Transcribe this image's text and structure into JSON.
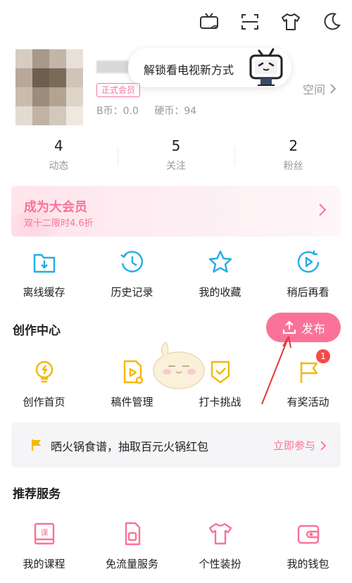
{
  "tooltip": {
    "text": "解锁看电视新方式"
  },
  "profile": {
    "member_badge": "正式会员",
    "b_coin": "B币：0.0",
    "hard_coin": "硬币：94",
    "space_label": "空间"
  },
  "stats": [
    {
      "value": "4",
      "label": "动态"
    },
    {
      "value": "5",
      "label": "关注"
    },
    {
      "value": "2",
      "label": "粉丝"
    }
  ],
  "vip_banner": {
    "title": "成为大会员",
    "subtitle": "双十二限时4.6折"
  },
  "quick_actions": [
    {
      "label": "离线缓存",
      "icon": "download-folder-icon"
    },
    {
      "label": "历史记录",
      "icon": "history-clock-icon"
    },
    {
      "label": "我的收藏",
      "icon": "star-icon"
    },
    {
      "label": "稍后再看",
      "icon": "watch-later-icon"
    }
  ],
  "creation": {
    "title": "创作中心",
    "publish_label": "发布",
    "items": [
      {
        "label": "创作首页",
        "icon": "bulb-icon"
      },
      {
        "label": "稿件管理",
        "icon": "manuscript-icon"
      },
      {
        "label": "打卡挑战",
        "icon": "checkin-shield-icon"
      },
      {
        "label": "有奖活动",
        "icon": "reward-flag-icon",
        "badge": "1"
      }
    ]
  },
  "event": {
    "text": "晒火锅食谱，抽取百元火锅红包",
    "link": "立即参与"
  },
  "services": {
    "title": "推荐服务",
    "items": [
      {
        "label": "我的课程",
        "icon": "course-icon"
      },
      {
        "label": "免流量服务",
        "icon": "sim-card-icon"
      },
      {
        "label": "个性装扮",
        "icon": "tshirt-icon"
      },
      {
        "label": "我的钱包",
        "icon": "wallet-icon"
      }
    ]
  },
  "colors": {
    "accent": "#fb7299",
    "icon_blue": "#23ade5",
    "creation_yellow": "#f5b800",
    "badge_red": "#f44a4a"
  }
}
